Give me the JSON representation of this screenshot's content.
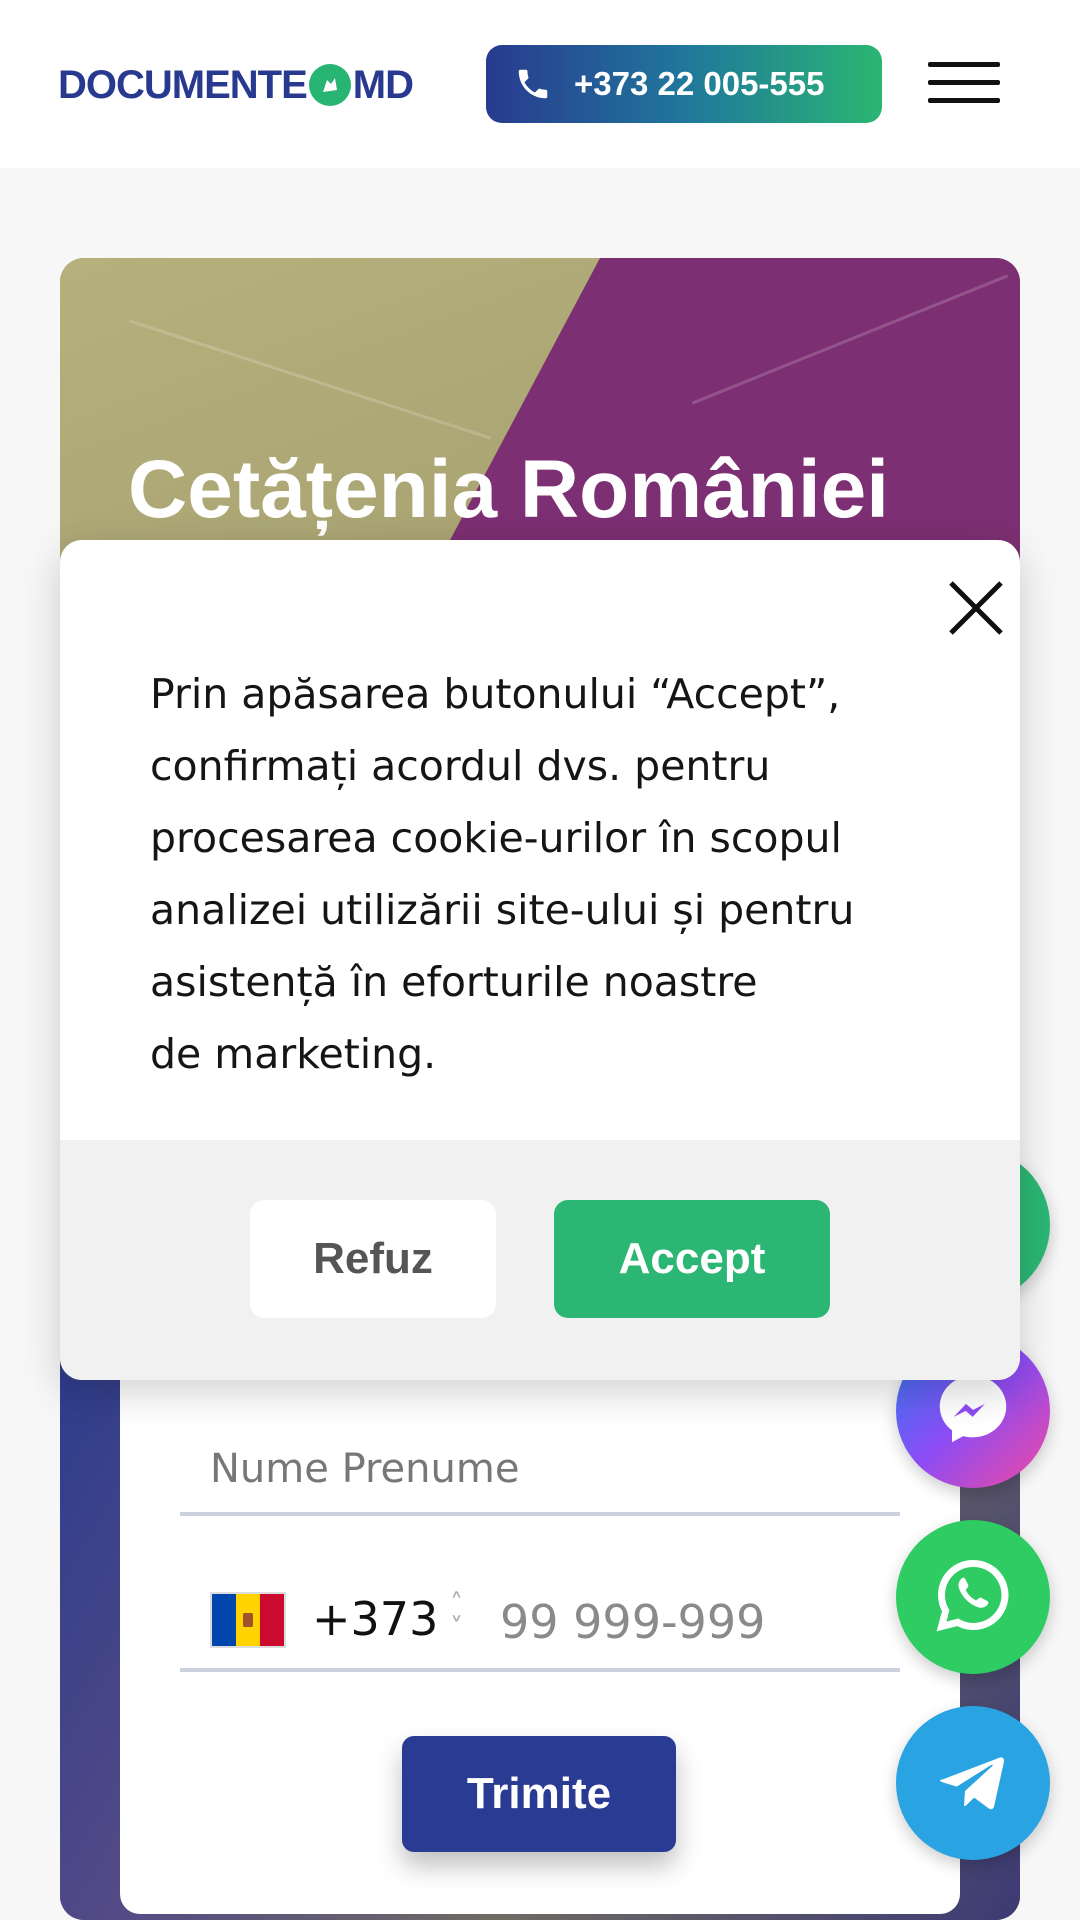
{
  "header": {
    "logo_left": "DOCUMENTE",
    "logo_right": "MD",
    "phone_label": "+373 22 005-555",
    "menu_icon": "hamburger-icon"
  },
  "hero": {
    "title": "Cetățenia României"
  },
  "form": {
    "name_placeholder": "Nume Prenume",
    "dial_code": "+373",
    "phone_placeholder": "99 999-999",
    "submit_label": "Trimite",
    "flag_colors": [
      "#0046ae",
      "#ffd200",
      "#cc092f"
    ]
  },
  "floating_buttons": [
    "messenger-icon",
    "whatsapp-icon",
    "telegram-icon"
  ],
  "cookie": {
    "text": "Prin apăsarea butonului “Accept”,\nconfirmați acordul dvs. pentru\nprocesarea cookie-urilor în scopul\nanalizei utilizării site-ului și pentru\nasistență în eforturile noastre\nde marketing.",
    "refuse_label": "Refuz",
    "accept_label": "Accept"
  },
  "colors": {
    "brand_blue": "#283a8f",
    "brand_green": "#2bb673"
  }
}
